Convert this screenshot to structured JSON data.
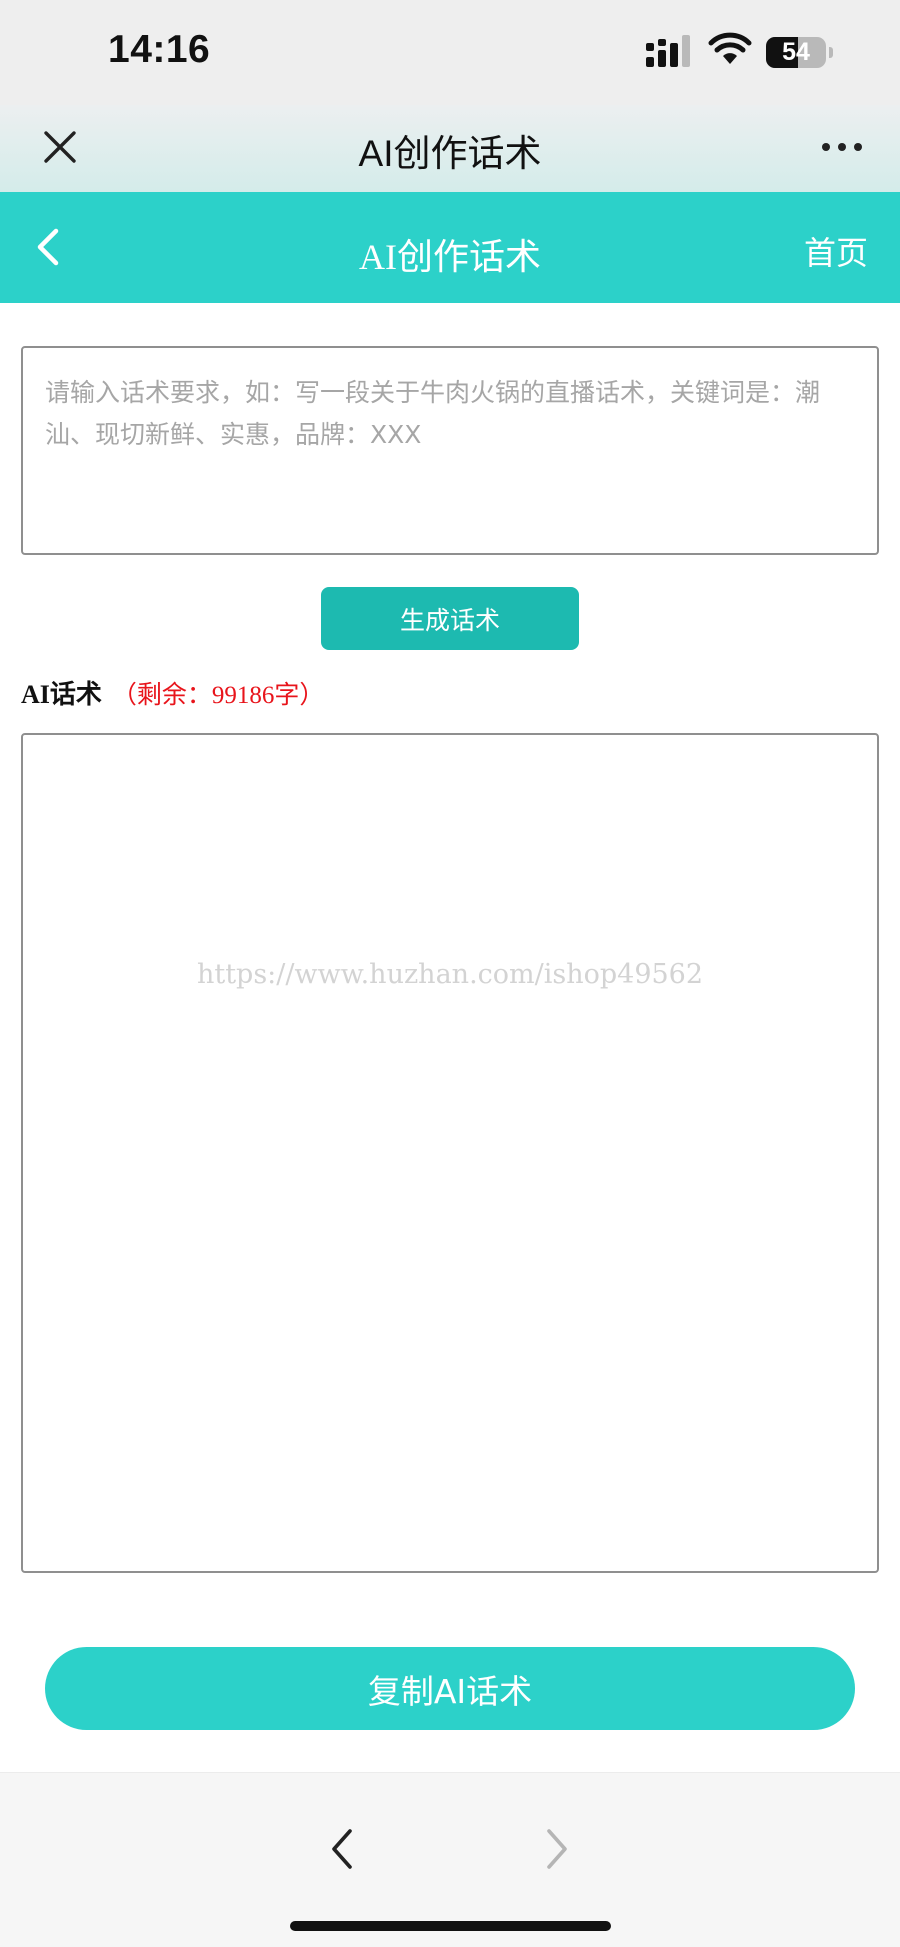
{
  "status_bar": {
    "time": "14:16",
    "battery_percent": 54,
    "battery_label": "54",
    "signal_icon": "signal-bars-icon",
    "wifi_icon": "wifi-icon"
  },
  "wechat_bar": {
    "title": "AI创作话术",
    "close_icon": "close-icon",
    "more_icon": "more-dots-icon"
  },
  "app_header": {
    "title": "AI创作话术",
    "home_label": "首页",
    "back_icon": "chevron-left-icon",
    "background_color": "#2cd1c9"
  },
  "prompt": {
    "value": "",
    "placeholder": "请输入话术要求，如：写一段关于牛肉火锅的直播话术，关键词是：潮汕、现切新鲜、实惠，品牌：XXX"
  },
  "generate_button": {
    "label": "生成话术",
    "color": "#1dbab0"
  },
  "result": {
    "label": "AI话术",
    "remaining": "（剩余：99186字）",
    "remaining_color": "#e8141b",
    "value": ""
  },
  "watermark": "https://www.huzhan.com/ishop49562",
  "copy_button": {
    "label": "复制AI话术"
  },
  "bottom_nav": {
    "back_icon": "chevron-left-icon",
    "forward_icon": "chevron-right-icon"
  }
}
